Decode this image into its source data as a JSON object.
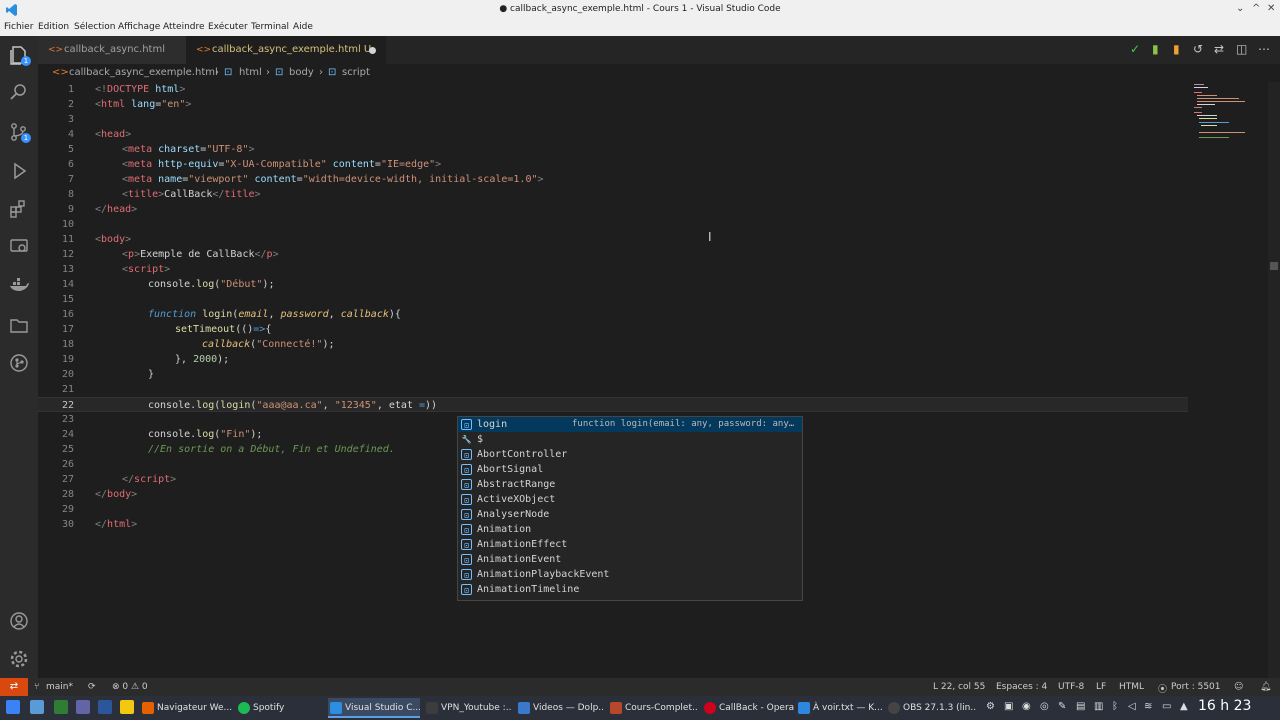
{
  "window": {
    "title": "● callback_async_exemple.html - Cours 1 - Visual Studio Code",
    "controls": [
      "⌄",
      "^",
      "✕"
    ]
  },
  "menu": [
    "Fichier",
    "Edition",
    "Sélection",
    "Affichage",
    "Atteindre",
    "Exécuter",
    "Terminal",
    "Aide"
  ],
  "activity": {
    "explorer_badge": "1",
    "scm_badge": "1",
    "icons": [
      "files-icon",
      "search-icon",
      "source-control-icon",
      "run-debug-icon",
      "extensions-icon",
      "remote-explorer-icon",
      "docker-icon",
      "folder-icon",
      "git-graph-icon"
    ]
  },
  "tabs": [
    {
      "label": "callback_async.html"
    },
    {
      "label": "callback_async_exemple.html U"
    }
  ],
  "breadcrumb": [
    "callback_async_exemple.html",
    "html",
    "body",
    "script"
  ],
  "editor": {
    "current_line": 22,
    "lines": [
      {
        "n": "1"
      },
      {
        "n": "2"
      },
      {
        "n": "3"
      },
      {
        "n": "4"
      },
      {
        "n": "5"
      },
      {
        "n": "6"
      },
      {
        "n": "7"
      },
      {
        "n": "8"
      },
      {
        "n": "9"
      },
      {
        "n": "10"
      },
      {
        "n": "11"
      },
      {
        "n": "12"
      },
      {
        "n": "13"
      },
      {
        "n": "14"
      },
      {
        "n": "15"
      },
      {
        "n": "16"
      },
      {
        "n": "17"
      },
      {
        "n": "18"
      },
      {
        "n": "19"
      },
      {
        "n": "20"
      },
      {
        "n": "21"
      },
      {
        "n": "22"
      },
      {
        "n": "23"
      },
      {
        "n": "24"
      },
      {
        "n": "25"
      },
      {
        "n": "26"
      },
      {
        "n": "27"
      },
      {
        "n": "28"
      },
      {
        "n": "29"
      },
      {
        "n": "30"
      }
    ],
    "code": {
      "l1a": "<!",
      "l1b": "DOCTYPE",
      "l1c": " html",
      "l1d": ">",
      "l2a": "<",
      "l2b": "html",
      "l2c": " lang",
      "l2d": "=",
      "l2e": "\"en\"",
      "l2f": ">",
      "l4a": "<",
      "l4b": "head",
      "l4c": ">",
      "l5a": "<",
      "l5b": "meta",
      "l5c": " charset",
      "l5d": "=",
      "l5e": "\"UTF-8\"",
      "l5f": ">",
      "l6a": "<",
      "l6b": "meta",
      "l6c": " http-equiv",
      "l6d": "=",
      "l6e": "\"X-UA-Compatible\"",
      "l6f": " content",
      "l6g": "=",
      "l6h": "\"IE=edge\"",
      "l6i": ">",
      "l7a": "<",
      "l7b": "meta",
      "l7c": " name",
      "l7d": "=",
      "l7e": "\"viewport\"",
      "l7f": " content",
      "l7g": "=",
      "l7h": "\"width=device-width, initial-scale=1.0\"",
      "l7i": ">",
      "l8a": "<",
      "l8b": "title",
      "l8c": ">",
      "l8d": "CallBack",
      "l8e": "</",
      "l8f": "title",
      "l8g": ">",
      "l9a": "</",
      "l9b": "head",
      "l9c": ">",
      "l11a": "<",
      "l11b": "body",
      "l11c": ">",
      "l12a": "<",
      "l12b": "p",
      "l12c": ">",
      "l12d": "Exemple de CallBack",
      "l12e": "</",
      "l12f": "p",
      "l12g": ">",
      "l13a": "<",
      "l13b": "script",
      "l13c": ">",
      "l14a": "console.",
      "l14b": "log",
      "l14c": "(",
      "l14d": "\"Début\"",
      "l14e": ");",
      "l16a": "function",
      "l16b": " login",
      "l16c": "(",
      "l16d": "email",
      "l16e": ", ",
      "l16f": "password",
      "l16g": ", ",
      "l16h": "callback",
      "l16i": "){",
      "l17a": "setTimeout",
      "l17b": "(()",
      "l17c": "=>",
      "l17d": "{",
      "l18a": "callback",
      "l18b": "(",
      "l18c": "\"Connecté!\"",
      "l18d": ");",
      "l19a": "}, ",
      "l19b": "2000",
      "l19c": ");",
      "l20a": "}",
      "l22a": "console.",
      "l22b": "log",
      "l22c": "(",
      "l22d": "login",
      "l22e": "(",
      "l22f": "\"aaa@aa.ca\"",
      "l22g": ", ",
      "l22h": "\"12345\"",
      "l22i": ", etat ",
      "l22j": "=",
      "l22k": "))",
      "l24a": "console.",
      "l24b": "log",
      "l24c": "(",
      "l24d": "\"Fin\"",
      "l24e": ");",
      "l25a": "//En sortie on a Début, Fin et Undefined.",
      "l27a": "</",
      "l27b": "script",
      "l27c": ">",
      "l28a": "</",
      "l28b": "body",
      "l28c": ">",
      "l30a": "</",
      "l30b": "html",
      "l30c": ">"
    }
  },
  "suggest": {
    "items": [
      {
        "label": "login",
        "detail": "function login(email: any, password: any, callback: any): void",
        "kind": "⊡"
      },
      {
        "label": "$",
        "detail": "",
        "kind": "🔧"
      },
      {
        "label": "AbortController",
        "detail": "",
        "kind": "⊡"
      },
      {
        "label": "AbortSignal",
        "detail": "",
        "kind": "⊡"
      },
      {
        "label": "AbstractRange",
        "detail": "",
        "kind": "⊡"
      },
      {
        "label": "ActiveXObject",
        "detail": "",
        "kind": "⊡"
      },
      {
        "label": "AnalyserNode",
        "detail": "",
        "kind": "⊡"
      },
      {
        "label": "Animation",
        "detail": "",
        "kind": "⊡"
      },
      {
        "label": "AnimationEffect",
        "detail": "",
        "kind": "⊡"
      },
      {
        "label": "AnimationEvent",
        "detail": "",
        "kind": "⊡"
      },
      {
        "label": "AnimationPlaybackEvent",
        "detail": "",
        "kind": "⊡"
      },
      {
        "label": "AnimationTimeline",
        "detail": "",
        "kind": "⊡"
      }
    ]
  },
  "status": {
    "branch": "main*",
    "problems": "⊗ 0 ⚠ 0",
    "position": "L 22, col 55",
    "spaces": "Espaces : 4",
    "encoding": "UTF-8",
    "eol": "LF",
    "language": "HTML",
    "port": "Port : 5501"
  },
  "taskbar": {
    "apps": [
      {
        "label": "Navigateur We...",
        "color": "#e66000"
      },
      {
        "label": "Spotify",
        "color": "#1db954"
      },
      {
        "label": "Visual Studio C...",
        "color": "#2c8ee0"
      },
      {
        "label": "VPN_Youtube :...",
        "color": "#3c3c3c"
      },
      {
        "label": "Videos — Dolp...",
        "color": "#3a78c9"
      },
      {
        "label": "Cours-Complet...",
        "color": "#b7472a"
      },
      {
        "label": "CallBack - Opera",
        "color": "#d0021b"
      },
      {
        "label": "À voir.txt — K...",
        "color": "#2e86de"
      },
      {
        "label": "OBS 27.1.3 (lin...",
        "color": "#444444"
      }
    ],
    "clock": "16 h 23"
  },
  "colors": {
    "accent": "#007acc",
    "remote": "#d9480f",
    "selection": "#04395e"
  }
}
